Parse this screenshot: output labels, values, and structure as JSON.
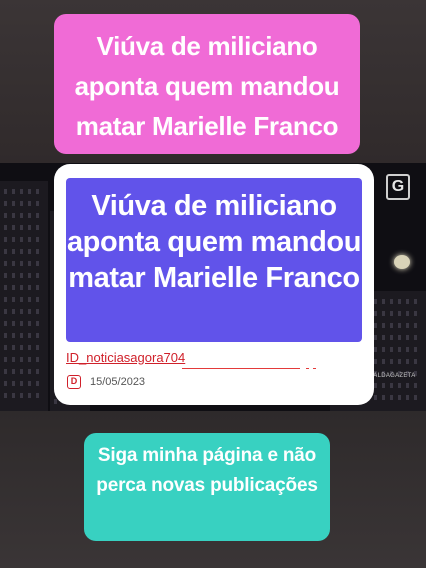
{
  "top_banner": {
    "text": "Viúva de miliciano aponta quem mandou matar Marielle Franco",
    "color": "#f06bd6"
  },
  "video": {
    "tv_logo": "G",
    "watermark": "RNALDAGAZETA"
  },
  "card": {
    "title": "Viúva de miliciano aponta quem mandou matar Marielle Franco",
    "title_bg": "#6153ea",
    "id_text": "ID_noticiasagora704",
    "date_icon": "D",
    "date": "15/05/2023"
  },
  "bottom_banner": {
    "text": "Siga minha página e não perca novas publicações",
    "color": "#38d1c1"
  }
}
